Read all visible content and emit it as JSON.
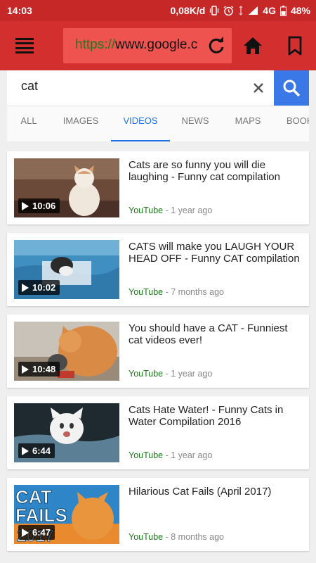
{
  "status_bar": {
    "time": "14:03",
    "network_speed": "0,08K/d",
    "network_type": "4G",
    "battery": "48%",
    "icons": [
      "vibrate-icon",
      "alarm-icon",
      "signal-icon",
      "battery-icon"
    ]
  },
  "toolbar": {
    "url_scheme": "https://",
    "url_rest": "www.google.c",
    "icons": [
      "menu-icon",
      "reload-icon",
      "home-icon",
      "bookmark-icon"
    ]
  },
  "search": {
    "query": "cat",
    "icons": [
      "clear-icon",
      "search-icon"
    ]
  },
  "tabs": [
    {
      "label": "ALL",
      "active": false
    },
    {
      "label": "IMAGES",
      "active": false
    },
    {
      "label": "VIDEOS",
      "active": true
    },
    {
      "label": "NEWS",
      "active": false
    },
    {
      "label": "MAPS",
      "active": false
    },
    {
      "label": "BOOK",
      "active": false
    }
  ],
  "results": [
    {
      "title": "Cats are so funny you will die laughing - Funny cat compilation",
      "source": "YouTube",
      "age": " - 1 year ago",
      "duration": "10:06"
    },
    {
      "title": "CATS will make you LAUGH YOUR HEAD OFF - Funny CAT compilation",
      "source": "YouTube",
      "age": " - 7 months ago",
      "duration": "10:02"
    },
    {
      "title": "You should have a CAT - Funniest cat videos ever!",
      "source": "YouTube",
      "age": " - 1 year ago",
      "duration": "10:48"
    },
    {
      "title": "Cats Hate Water! - Funny Cats in Water Compilation 2016",
      "source": "YouTube",
      "age": " - 1 year ago",
      "duration": "6:44"
    },
    {
      "title": "Hilarious Cat Fails (April 2017)",
      "source": "YouTube",
      "age": " - 8 months ago",
      "duration": "6:47",
      "thumb_text": [
        "CAT",
        "FAILS",
        "2017"
      ]
    }
  ],
  "colors": {
    "status_bar": "#c62828",
    "toolbar": "#d32f2f",
    "url_box": "#ef5350",
    "accent": "#1a73e8",
    "source_green": "#1b7a1b"
  }
}
